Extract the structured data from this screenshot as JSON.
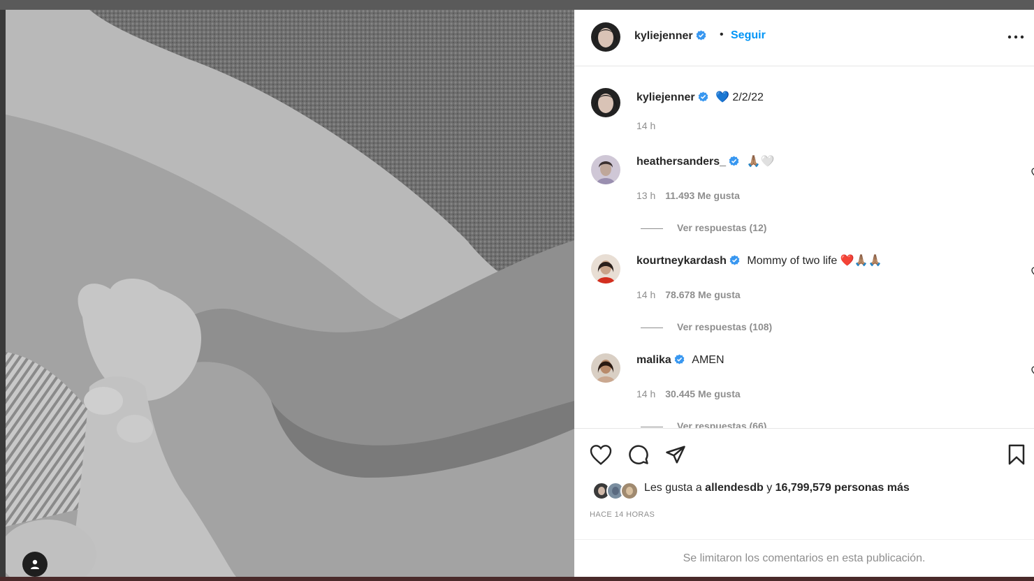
{
  "post": {
    "author": "kyliejenner",
    "follow_label": "Seguir",
    "dot": "•",
    "caption": {
      "username": "kyliejenner",
      "text": "💙 2/2/22",
      "age": "14 h"
    }
  },
  "comments": [
    {
      "username": "heathersanders_",
      "text": "🙏🏽🤍",
      "age": "13 h",
      "likes": "11.493 Me gusta",
      "replies": "Ver respuestas (12)"
    },
    {
      "username": "kourtneykardash",
      "text": "Mommy of two life ❤️🙏🏽🙏🏽",
      "age": "14 h",
      "likes": "78.678 Me gusta",
      "replies": "Ver respuestas (108)"
    },
    {
      "username": "malika",
      "text": "AMEN",
      "age": "14 h",
      "likes": "30.445 Me gusta",
      "replies": "Ver respuestas (66)"
    }
  ],
  "likes_summary": {
    "prefix": "Les gusta a ",
    "user": "allendesdb",
    "middle": " y ",
    "count": "16,799,579 personas más"
  },
  "time_ago": "HACE 14 HORAS",
  "comments_limited": "Se limitaron los comentarios en esta publicación.",
  "colors": {
    "accent": "#0095f6",
    "verified": "#3897f0",
    "muted": "#8e8e8e"
  },
  "icons": [
    "verified-badge-icon",
    "more-options-icon",
    "heart-icon",
    "comment-icon",
    "share-icon",
    "bookmark-icon",
    "user-tag-icon"
  ]
}
